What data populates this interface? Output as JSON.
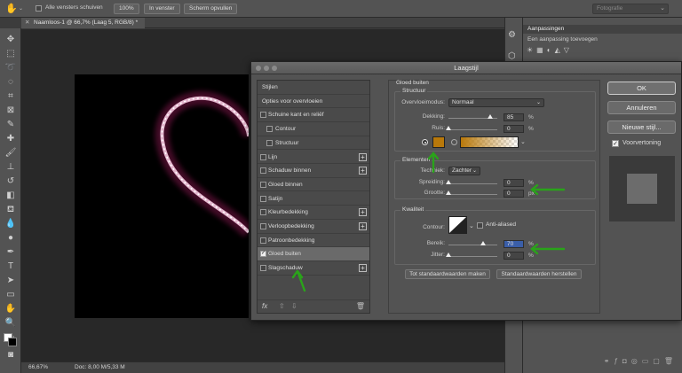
{
  "optbar": {
    "checkbox_label": "Alle vensters schuiven",
    "zoom": "100%",
    "fit_button": "In venster",
    "fill_button": "Scherm opvullen",
    "workspace": "Fotografie"
  },
  "tab": {
    "title": "Naamloos-1 @ 66,7% (Laag 5, RGB/8) *"
  },
  "status": {
    "zoom": "66,67%",
    "doc": "Doc: 8,00 M/5,33 M"
  },
  "panel": {
    "title": "Aanpassingen",
    "subtitle": "Een aanpassing toevoegen"
  },
  "dialog": {
    "title": "Laagstijl",
    "list": [
      {
        "label": "Stijlen",
        "check": false,
        "plus": false,
        "indent": 0,
        "header": true
      },
      {
        "label": "Opties voor overvloeien",
        "check": false,
        "plus": false,
        "indent": 0,
        "header": true
      },
      {
        "label": "Schuine kant en reliëf",
        "check": true,
        "plus": false,
        "indent": 0
      },
      {
        "label": "Contour",
        "check": true,
        "plus": false,
        "indent": 1
      },
      {
        "label": "Structuur",
        "check": true,
        "plus": false,
        "indent": 1
      },
      {
        "label": "Lijn",
        "check": true,
        "plus": true,
        "indent": 0
      },
      {
        "label": "Schaduw binnen",
        "check": true,
        "plus": true,
        "indent": 0
      },
      {
        "label": "Gloed binnen",
        "check": true,
        "plus": false,
        "indent": 0
      },
      {
        "label": "Satijn",
        "check": true,
        "plus": false,
        "indent": 0
      },
      {
        "label": "Kleurbedekking",
        "check": true,
        "plus": true,
        "indent": 0
      },
      {
        "label": "Verloopbedekking",
        "check": true,
        "plus": true,
        "indent": 0
      },
      {
        "label": "Patroonbedekking",
        "check": true,
        "plus": false,
        "indent": 0
      },
      {
        "label": "Gloed buiten",
        "check": true,
        "plus": false,
        "indent": 0,
        "checked": true,
        "selected": true
      },
      {
        "label": "Slagschaduw",
        "check": true,
        "plus": true,
        "indent": 0
      }
    ],
    "section_title": "Gloed buiten",
    "structuur": {
      "title": "Structuur",
      "blend_label": "Overvloeimodus:",
      "blend_value": "Normaal",
      "opacity_label": "Dekking:",
      "opacity_value": "85",
      "noise_label": "Ruis:",
      "noise_value": "0",
      "unit_pct": "%"
    },
    "elementen": {
      "title": "Elementen",
      "technique_label": "Techniek:",
      "technique_value": "Zachter",
      "spread_label": "Spreiding:",
      "spread_value": "0",
      "size_label": "Grootte:",
      "size_value": "0",
      "unit_px": "px"
    },
    "kwaliteit": {
      "title": "Kwaliteit",
      "contour_label": "Contour:",
      "antialias_label": "Anti-aliased",
      "range_label": "Bereik:",
      "range_value": "70",
      "jitter_label": "Jitter:",
      "jitter_value": "0"
    },
    "make_default": "Tot standaardwaarden maken",
    "reset_default": "Standaardwaarden herstellen",
    "ok": "OK",
    "cancel": "Annuleren",
    "new_style": "Nieuwe stijl...",
    "preview_label": "Voorvertoning",
    "glow_color": "#b8780a",
    "annotation_color": "#2aa31a"
  }
}
